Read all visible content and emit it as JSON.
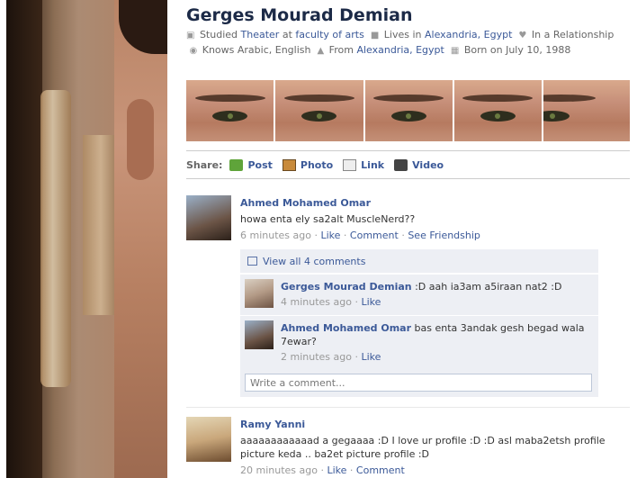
{
  "profile": {
    "name": "Gerges Mourad Demian",
    "info": {
      "studied_prefix": "Studied",
      "studied_subject": "Theater",
      "at": "at",
      "school": "faculty of arts",
      "lives_prefix": "Lives in",
      "lives_city": "Alexandria, Egypt",
      "relationship": "In a Relationship",
      "knows": "Knows Arabic, English",
      "from_prefix": "From",
      "from_city": "Alexandria, Egypt",
      "born": "Born on July 10, 1988"
    }
  },
  "share": {
    "label": "Share:",
    "items": [
      "Post",
      "Photo",
      "Link",
      "Video"
    ]
  },
  "stories": [
    {
      "author": "Ahmed Mohamed Omar",
      "message": "howa enta ely sa2alt MuscleNerd??",
      "time": "6 minutes ago",
      "actions": [
        "Like",
        "Comment",
        "See Friendship"
      ],
      "view_all": "View all 4 comments",
      "comments": [
        {
          "author": "Gerges Mourad Demian",
          "text": ":D aah ia3am a5iraan nat2 :D",
          "time": "4 minutes ago",
          "action": "Like"
        },
        {
          "author": "Ahmed Mohamed Omar",
          "text": "bas enta 3andak gesh begad wala 7ewar?",
          "time": "2 minutes ago",
          "action": "Like"
        }
      ],
      "write_placeholder": "Write a comment..."
    },
    {
      "author": "Ramy Yanni",
      "message": "aaaaaaaaaaaad a gegaaaa :D I love ur profile :D :D asl maba2etsh profile picture keda .. ba2et picture profile :D",
      "time": "20 minutes ago",
      "actions": [
        "Like",
        "Comment"
      ]
    }
  ],
  "separator": "·"
}
